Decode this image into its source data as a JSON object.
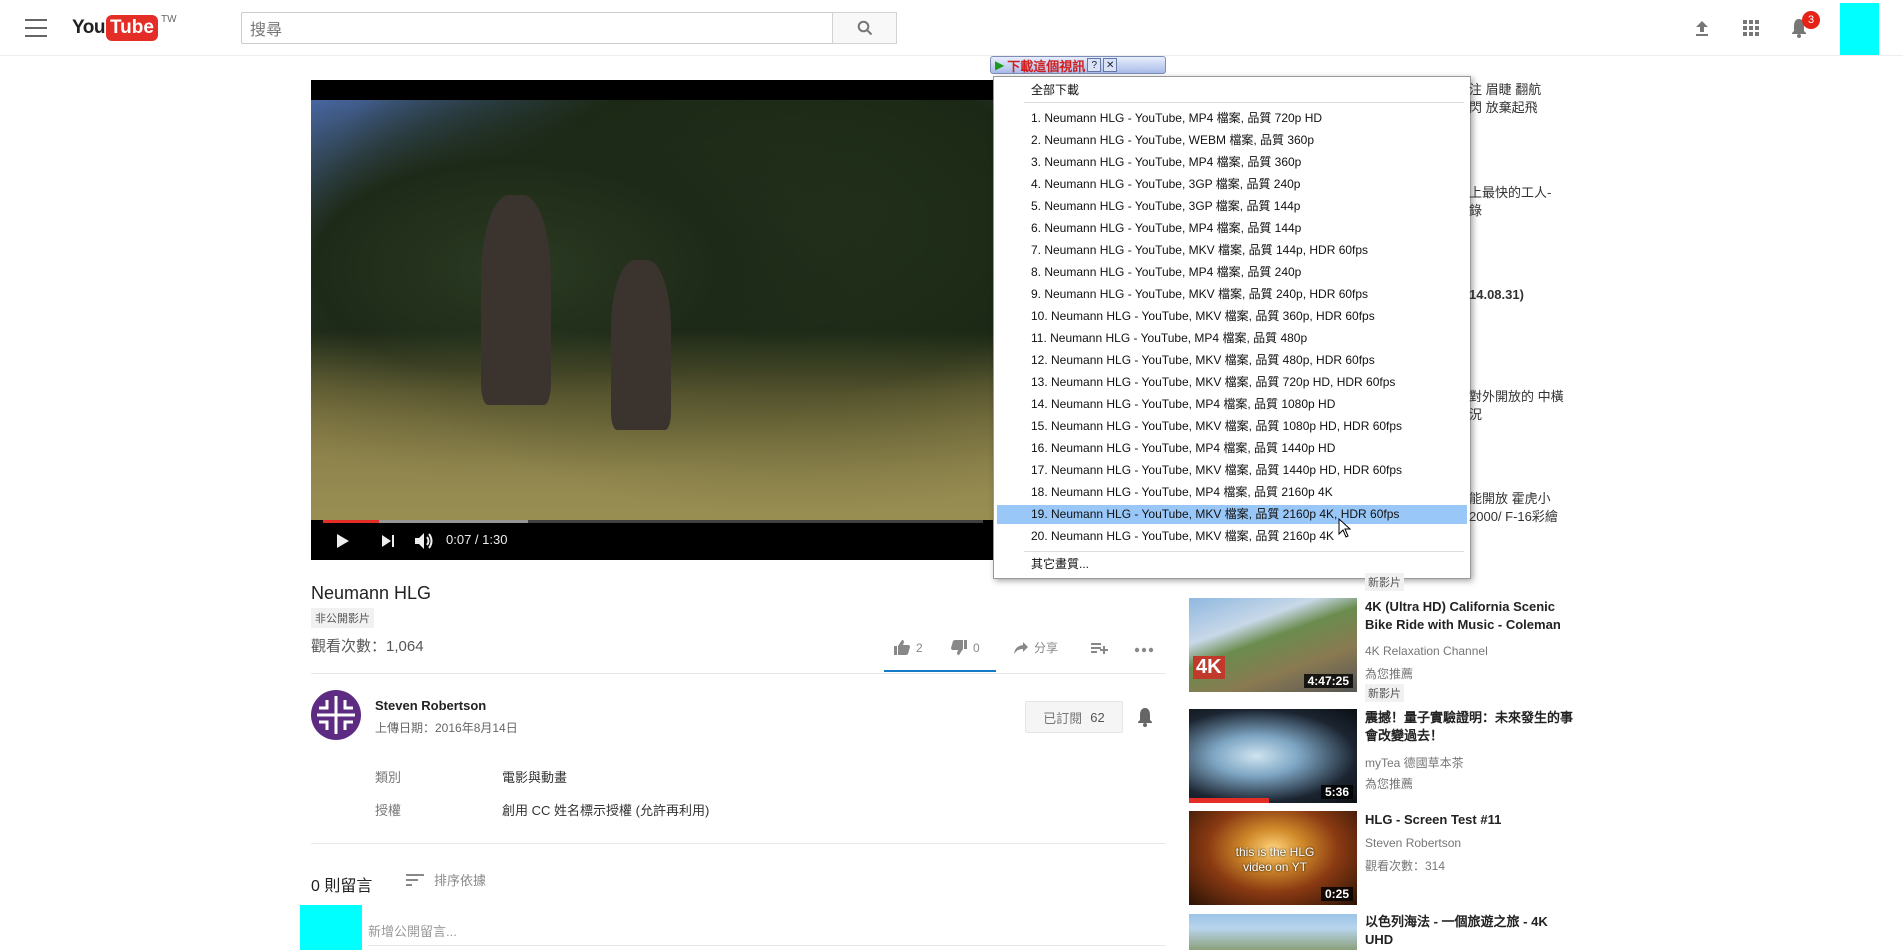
{
  "header": {
    "logo_you": "You",
    "logo_tube": "Tube",
    "logo_country": "TW",
    "search_placeholder": "搜尋",
    "notification_count": "3"
  },
  "player": {
    "time": "0:07 / 1:30",
    "progress_played": 0.085,
    "progress_buffered": 0.31
  },
  "download": {
    "bar_label": "下載這個視訊",
    "help": "?",
    "close": "✕",
    "all_label": "全部下載",
    "more_label": "其它畫質...",
    "highlight_index": 18,
    "items": [
      "1.  Neumann HLG - YouTube,  MP4 檔案, 品質 720p HD",
      "2.  Neumann HLG - YouTube,  WEBM 檔案, 品質 360p",
      "3.  Neumann HLG - YouTube,  MP4 檔案, 品質 360p",
      "4.  Neumann HLG - YouTube,  3GP 檔案, 品質 240p",
      "5.  Neumann HLG - YouTube,  3GP 檔案, 品質 144p",
      "6.  Neumann HLG - YouTube,  MP4 檔案, 品質 144p",
      "7.  Neumann HLG - YouTube,  MKV 檔案, 品質 144p, HDR 60fps",
      "8.  Neumann HLG - YouTube,  MP4 檔案, 品質 240p",
      "9.  Neumann HLG - YouTube,  MKV 檔案, 品質 240p, HDR 60fps",
      "10.  Neumann HLG - YouTube,  MKV 檔案, 品質 360p, HDR 60fps",
      "11.  Neumann HLG - YouTube,  MP4 檔案, 品質 480p",
      "12.  Neumann HLG - YouTube,  MKV 檔案, 品質 480p, HDR 60fps",
      "13.  Neumann HLG - YouTube,  MKV 檔案, 品質 720p HD, HDR 60fps",
      "14.  Neumann HLG - YouTube,  MP4 檔案, 品質 1080p HD",
      "15.  Neumann HLG - YouTube,  MKV 檔案, 品質 1080p HD, HDR 60fps",
      "16.  Neumann HLG - YouTube,  MP4 檔案, 品質 1440p HD",
      "17.  Neumann HLG - YouTube,  MKV 檔案, 品質 1440p HD, HDR 60fps",
      "18.  Neumann HLG - YouTube,  MP4 檔案, 品質 2160p 4K",
      "19.  Neumann HLG - YouTube,  MKV 檔案, 品質 2160p 4K, HDR 60fps",
      "20.  Neumann HLG - YouTube,  MKV 檔案, 品質 2160p 4K"
    ]
  },
  "video": {
    "title": "Neumann HLG",
    "privacy": "非公開影片",
    "views": "觀看次數：1,064",
    "likes": "2",
    "dislikes": "0",
    "share": "分享",
    "like_ratio": 1.0
  },
  "channel": {
    "name": "Steven Robertson",
    "upload_date": "上傳日期：2016年8月14日",
    "subscribed_label": "已訂閱",
    "subscriber_count": "62"
  },
  "meta": {
    "category_label": "類別",
    "category_value": "電影與動畫",
    "license_label": "授權",
    "license_value": "創用 CC 姓名標示授權 (允許再利用)"
  },
  "comments": {
    "count": "0 則留言",
    "sort": "排序依據",
    "placeholder": "新增公開留言..."
  },
  "sidebar_clipped": [
    "注 眉睫 翻航",
    "閃 放棄起飛",
    "上最快的工人-",
    "錄",
    "14.08.31)",
    "對外開放的 中橫",
    "況",
    "能開放 霍虎小",
    "2000/ F-16彩繪"
  ],
  "related": [
    {
      "title": "4K (Ultra HD) California Scenic Bike Ride with Music - Coleman",
      "channel": "4K Relaxation Channel",
      "extra": "為您推薦",
      "tag": "新影片",
      "duration": "4:47:25",
      "thumb_label": "4K"
    },
    {
      "title": "震撼！量子實驗證明：未來發生的事會改變過去！",
      "channel": "myTea 德國草本茶",
      "extra": "為您推薦",
      "duration": "5:36"
    },
    {
      "title": "HLG - Screen Test #11",
      "channel": "Steven Robertson",
      "extra": "觀看次數：314",
      "duration": "0:25",
      "thumb_text": "this is the HLG video on YT"
    },
    {
      "title": "以色列海法 - 一個旅遊之旅 - 4K UHD"
    }
  ],
  "partial_tag": "新影片"
}
